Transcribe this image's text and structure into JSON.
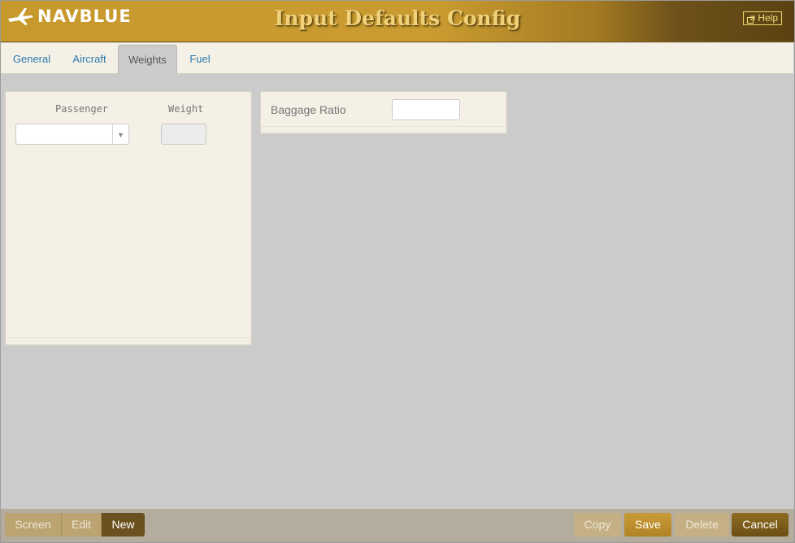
{
  "app": {
    "logo_text": "NAVBLUE",
    "title": "Input Defaults Config",
    "help_label": "Help"
  },
  "tabs": [
    {
      "label": "General",
      "active": false
    },
    {
      "label": "Aircraft",
      "active": false
    },
    {
      "label": "Weights",
      "active": true
    },
    {
      "label": "Fuel",
      "active": false
    }
  ],
  "weights_panel": {
    "passenger_header": "Passenger",
    "weight_header": "Weight",
    "passenger_value": "",
    "weight_value": ""
  },
  "baggage_panel": {
    "label": "Baggage Ratio",
    "value": ""
  },
  "mode_buttons": [
    {
      "label": "Screen",
      "active": false
    },
    {
      "label": "Edit",
      "active": false
    },
    {
      "label": "New",
      "active": true
    }
  ],
  "actions": {
    "copy": "Copy",
    "save": "Save",
    "delete": "Delete",
    "cancel": "Cancel"
  },
  "colors": {
    "brand_gold": "#c99b30",
    "brand_dark": "#5a4212",
    "link_blue": "#2a7ab0",
    "panel_bg": "#f5f0e6"
  }
}
